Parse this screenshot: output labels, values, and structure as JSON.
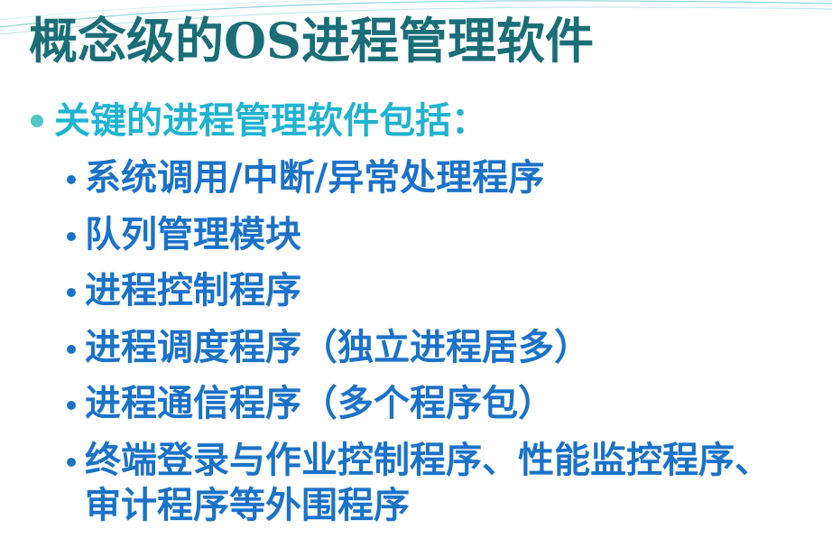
{
  "slide": {
    "title": "概念级的OS进程管理软件",
    "main_bullet": "关键的进程管理软件包括：",
    "sub_bullets": [
      "系统调用/中断/异常处理程序",
      "队列管理模块",
      "进程控制程序",
      "进程调度程序（独立进程居多）",
      "进程通信程序（多个程序包）",
      "终端登录与作业控制程序、性能监控程序、审计程序等外围程序"
    ]
  },
  "colors": {
    "title": "#1a6e78",
    "level1_text": "#1fb3d0",
    "level1_bullet": "#4fc6c8",
    "level2_text": "#1b72c8"
  }
}
